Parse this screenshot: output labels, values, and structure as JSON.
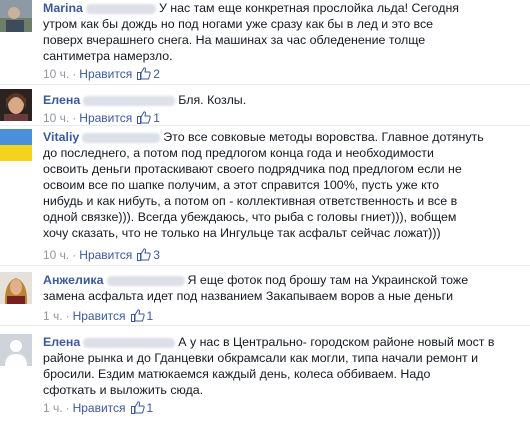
{
  "comments": [
    {
      "author": "Marina",
      "lines": [
        "У нас там еще конкретная прослойка льда! Сегодня",
        "утром как бы дождь но под ногами уже сразу как бы в лед и это все",
        "поверх вчерашнего снега. На машинах за час обледенение толще",
        "сантиметра намерзло."
      ],
      "time": "10 ч.",
      "like_label": "Нравится",
      "likes": "2"
    },
    {
      "author": "Елена",
      "lines": [
        "Бля. Козлы."
      ],
      "time": "10 ч.",
      "like_label": "Нравится",
      "likes": "1"
    },
    {
      "author": "Vitaliy",
      "lines": [
        "Это все совковые методы воровства. Главное дотянуть",
        "до последнего, а потом под предлогом конца года и необходимости",
        "освоить деньги протаскивают своего подрядчика под предлогом если не",
        "освоим все по шапке получим, а этот справится 100%, пусть уже кто",
        "нибудь и как нибуть, а потом оп - коллективная ответственность и все в",
        "одной связке))). Всегда убеждаюсь, что рыба с головы гниет))), вобщем",
        "хочу сказать, что не только на Ингульце так асфальт сейчас ложат)))"
      ],
      "time": "10 ч.",
      "like_label": "Нравится",
      "likes": "3"
    },
    {
      "author": "Анжелика",
      "lines": [
        "Я еще фоток под брошу там на Украинской тоже",
        "замена асфальта идет под названием Закапываем воров а ные деньги"
      ],
      "time": "1 ч.",
      "like_label": "Нравится",
      "likes": "1"
    },
    {
      "author": "Елена",
      "lines": [
        "А у нас в Центрально- городском районе новый мост в",
        "районе рынка и до Гданцевки обкрамсали как могли, типа начали ремонт и",
        "бросили. Ездим матюкаемся каждый день, колеса оббиваем. Надо",
        "сфоткать и выложить сюда."
      ],
      "time": "1 ч.",
      "like_label": "Нравится",
      "likes": "1"
    }
  ],
  "colors": {
    "author": "#3b5998",
    "meta": "#9197a3",
    "divider": "#e9eaed"
  }
}
